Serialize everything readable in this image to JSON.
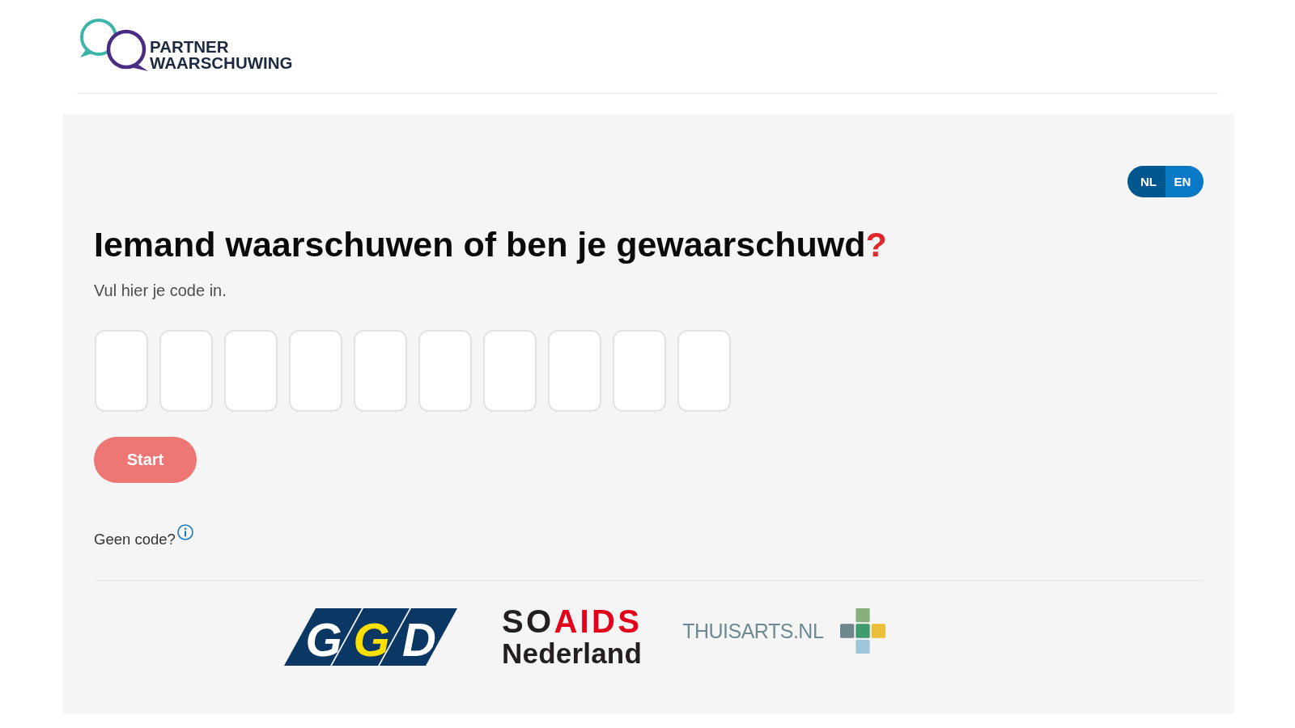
{
  "header": {
    "logo": {
      "lines": [
        "PARTNER",
        "WAARSCHUWING"
      ]
    }
  },
  "languages": [
    {
      "label": "NL",
      "selected": true
    },
    {
      "label": "EN",
      "selected": false
    }
  ],
  "heading": {
    "text": "Iemand waarschuwen of ben je gewaarschuwd",
    "mark": "?"
  },
  "instruction": "Vul hier je code in.",
  "code_fields": [
    {
      "kind": "digit"
    },
    {
      "kind": "digit"
    },
    {
      "kind": "digit"
    },
    {
      "kind": "digit"
    },
    {
      "kind": "digit"
    },
    {
      "kind": "digit"
    },
    {
      "kind": "digit"
    },
    {
      "kind": "digit"
    },
    {
      "kind": "digit"
    },
    {
      "kind": "digit"
    }
  ],
  "start_button": "Start",
  "no_code_label": "Geen code?",
  "partners": [
    {
      "kind": "ggd",
      "letters": [
        "G",
        "G",
        "D"
      ]
    },
    {
      "kind": "soa",
      "dark": "SO",
      "red": "AIDS",
      "line2": "Nederland"
    },
    {
      "kind": "thuisarts",
      "text": "THUISARTS.NL"
    }
  ]
}
